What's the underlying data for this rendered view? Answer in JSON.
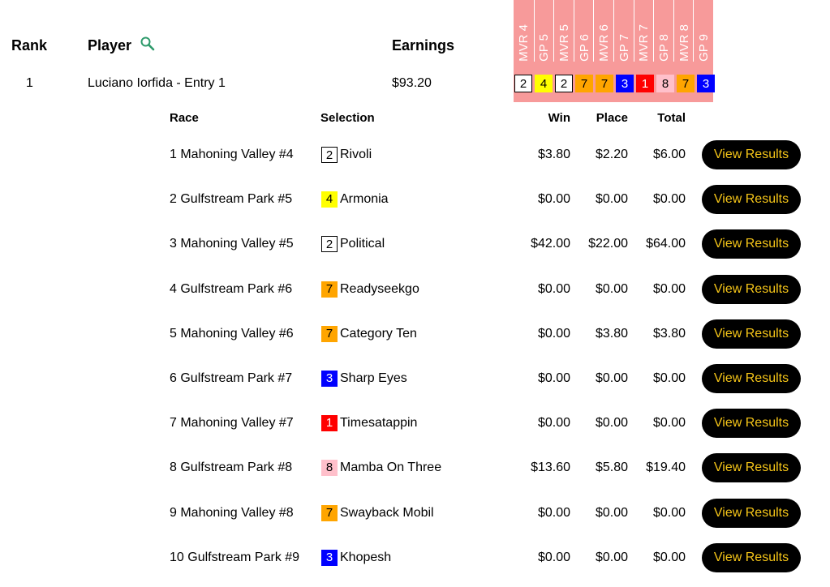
{
  "header": {
    "rank": "Rank",
    "player": "Player",
    "earnings": "Earnings"
  },
  "search_icon": "magnifier-icon",
  "colors": {
    "race_header_bg": "#f79a9a",
    "button_bg": "#000000",
    "button_text": "#f5c518",
    "search_icon": "#2e9a6b"
  },
  "races": [
    "MVR 4",
    "GP 5",
    "MVR 5",
    "GP 6",
    "MVR 6",
    "GP 7",
    "MVR 7",
    "GP 8",
    "MVR 8",
    "GP 9"
  ],
  "player_row": {
    "rank": "1",
    "name": "Luciano Iorfida - Entry 1",
    "earnings": "$93.20"
  },
  "picks": [
    {
      "num": "2",
      "bg": "#ffffff",
      "fg": "#000000",
      "border": "#000000"
    },
    {
      "num": "4",
      "bg": "#ffff00",
      "fg": "#000000",
      "border": "none"
    },
    {
      "num": "2",
      "bg": "#ffffff",
      "fg": "#000000",
      "border": "#000000"
    },
    {
      "num": "7",
      "bg": "#ffa500",
      "fg": "#000000",
      "border": "none"
    },
    {
      "num": "7",
      "bg": "#ffa500",
      "fg": "#000000",
      "border": "none"
    },
    {
      "num": "3",
      "bg": "#0000ff",
      "fg": "#ffffff",
      "border": "none"
    },
    {
      "num": "1",
      "bg": "#ff0000",
      "fg": "#ffffff",
      "border": "none"
    },
    {
      "num": "8",
      "bg": "#ffc0cb",
      "fg": "#000000",
      "border": "none"
    },
    {
      "num": "7",
      "bg": "#ffa500",
      "fg": "#000000",
      "border": "none"
    },
    {
      "num": "3",
      "bg": "#0000ff",
      "fg": "#ffffff",
      "border": "none"
    }
  ],
  "detail_headers": {
    "race": "Race",
    "selection": "Selection",
    "win": "Win",
    "place": "Place",
    "total": "Total"
  },
  "rows": [
    {
      "race": "1 Mahoning Valley #4",
      "num": "2",
      "horse": "Rivoli",
      "win": "$3.80",
      "place": "$2.20",
      "total": "$6.00",
      "button": "View Results"
    },
    {
      "race": "2 Gulfstream Park #5",
      "num": "4",
      "horse": "Armonia",
      "win": "$0.00",
      "place": "$0.00",
      "total": "$0.00",
      "button": "View Results"
    },
    {
      "race": "3 Mahoning Valley #5",
      "num": "2",
      "horse": "Political",
      "win": "$42.00",
      "place": "$22.00",
      "total": "$64.00",
      "button": "View Results"
    },
    {
      "race": "4 Gulfstream Park #6",
      "num": "7",
      "horse": "Readyseekgo",
      "win": "$0.00",
      "place": "$0.00",
      "total": "$0.00",
      "button": "View Results"
    },
    {
      "race": "5 Mahoning Valley #6",
      "num": "7",
      "horse": "Category Ten",
      "win": "$0.00",
      "place": "$3.80",
      "total": "$3.80",
      "button": "View Results"
    },
    {
      "race": "6 Gulfstream Park #7",
      "num": "3",
      "horse": "Sharp Eyes",
      "win": "$0.00",
      "place": "$0.00",
      "total": "$0.00",
      "button": "View Results"
    },
    {
      "race": "7 Mahoning Valley #7",
      "num": "1",
      "horse": "Timesatappin",
      "win": "$0.00",
      "place": "$0.00",
      "total": "$0.00",
      "button": "View Results"
    },
    {
      "race": "8 Gulfstream Park #8",
      "num": "8",
      "horse": "Mamba On Three",
      "win": "$13.60",
      "place": "$5.80",
      "total": "$19.40",
      "button": "View Results"
    },
    {
      "race": "9 Mahoning Valley #8",
      "num": "7",
      "horse": "Swayback Mobil",
      "win": "$0.00",
      "place": "$0.00",
      "total": "$0.00",
      "button": "View Results"
    },
    {
      "race": "10 Gulfstream Park #9",
      "num": "3",
      "horse": "Khopesh",
      "win": "$0.00",
      "place": "$0.00",
      "total": "$0.00",
      "button": "View Results"
    }
  ]
}
